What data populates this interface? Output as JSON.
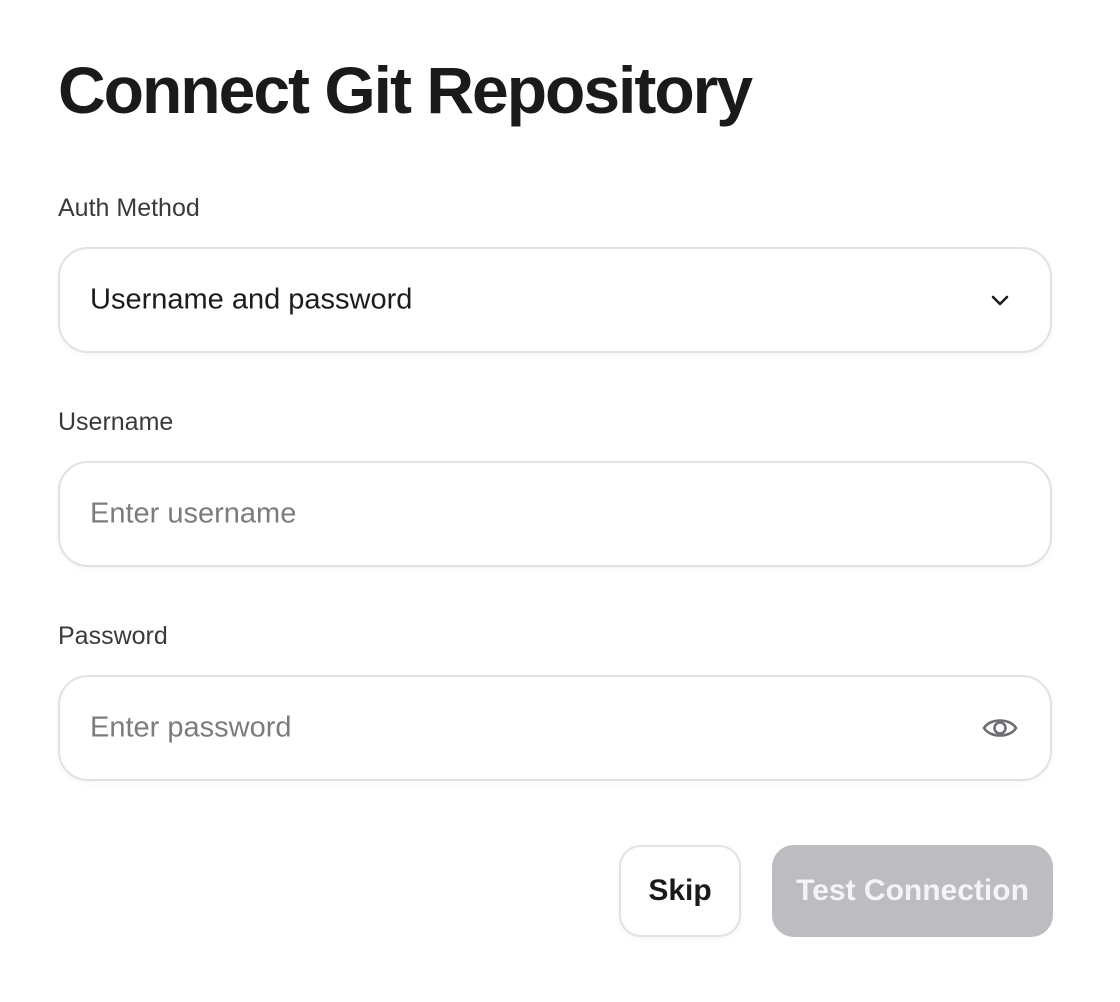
{
  "page": {
    "title": "Connect Git Repository"
  },
  "auth_method": {
    "label": "Auth Method",
    "selected": "Username and password",
    "icon": "chevron-down-icon"
  },
  "username": {
    "label": "Username",
    "value": "",
    "placeholder": "Enter username"
  },
  "password": {
    "label": "Password",
    "value": "",
    "placeholder": "Enter password",
    "icon": "eye-icon"
  },
  "actions": {
    "skip_label": "Skip",
    "test_label": "Test Connection",
    "test_disabled": true
  },
  "colors": {
    "background": "#ffffff",
    "text": "#1c1c1e",
    "placeholder": "#7c7c80",
    "border": "#e2e2e4",
    "disabled_button": "#bdbcc0",
    "disabled_button_text": "#f4f4f6"
  }
}
